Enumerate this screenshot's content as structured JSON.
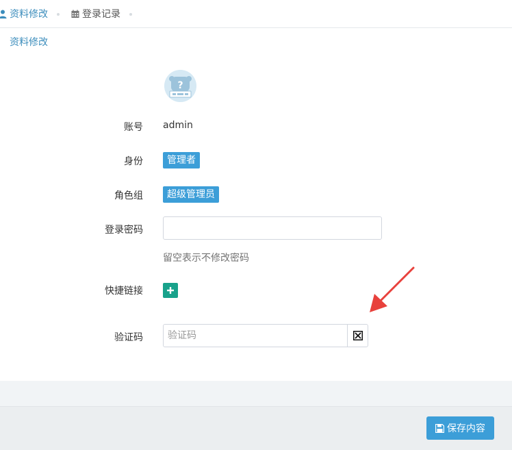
{
  "tabs": [
    {
      "label": "资料修改",
      "icon": "user-icon",
      "active": true
    },
    {
      "label": "登录记录",
      "icon": "calendar-icon",
      "active": false
    }
  ],
  "section_title": "资料修改",
  "avatar": {
    "icon": "avatar-placeholder-icon"
  },
  "form": {
    "account": {
      "label": "账号",
      "value": "admin"
    },
    "identity": {
      "label": "身份",
      "value": "管理者"
    },
    "role_group": {
      "label": "角色组",
      "value": "超级管理员"
    },
    "password": {
      "label": "登录密码",
      "value": "",
      "placeholder": "",
      "help": "留空表示不修改密码"
    },
    "shortcut": {
      "label": "快捷链接",
      "button_icon": "plus-icon"
    },
    "captcha": {
      "label": "验证码",
      "value": "",
      "placeholder": "验证码",
      "image_icon": "broken-image-icon"
    }
  },
  "footer": {
    "save_label": "保存内容",
    "save_icon": "floppy-disk-icon"
  },
  "colors": {
    "accent": "#3c9ed8",
    "link": "#3c8dbc",
    "teal": "#18a28b",
    "annotation": "#e8413c"
  }
}
